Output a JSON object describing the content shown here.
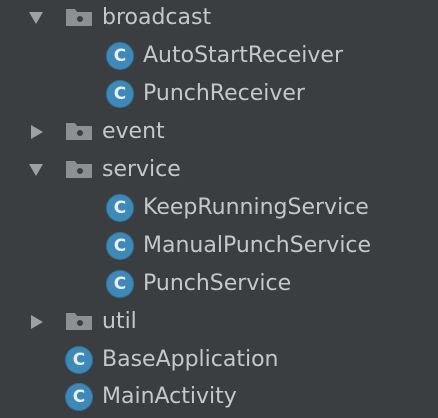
{
  "colors": {
    "background": "#3b3e40",
    "text": "#c5c8cb",
    "arrow": "#9ea1a4",
    "folder": "#8d9093",
    "class_icon": "#3f89b8"
  },
  "tree": {
    "items": [
      {
        "label": "broadcast",
        "kind": "package",
        "state": "expanded"
      },
      {
        "label": "AutoStartReceiver",
        "kind": "class",
        "icon_letter": "C"
      },
      {
        "label": "PunchReceiver",
        "kind": "class",
        "icon_letter": "C"
      },
      {
        "label": "event",
        "kind": "package",
        "state": "collapsed"
      },
      {
        "label": "service",
        "kind": "package",
        "state": "expanded"
      },
      {
        "label": "KeepRunningService",
        "kind": "class",
        "icon_letter": "C"
      },
      {
        "label": "ManualPunchService",
        "kind": "class",
        "icon_letter": "C"
      },
      {
        "label": "PunchService",
        "kind": "class",
        "icon_letter": "C"
      },
      {
        "label": "util",
        "kind": "package",
        "state": "collapsed"
      },
      {
        "label": "BaseApplication",
        "kind": "class",
        "icon_letter": "C"
      },
      {
        "label": "MainActivity",
        "kind": "class",
        "icon_letter": "C"
      }
    ]
  }
}
